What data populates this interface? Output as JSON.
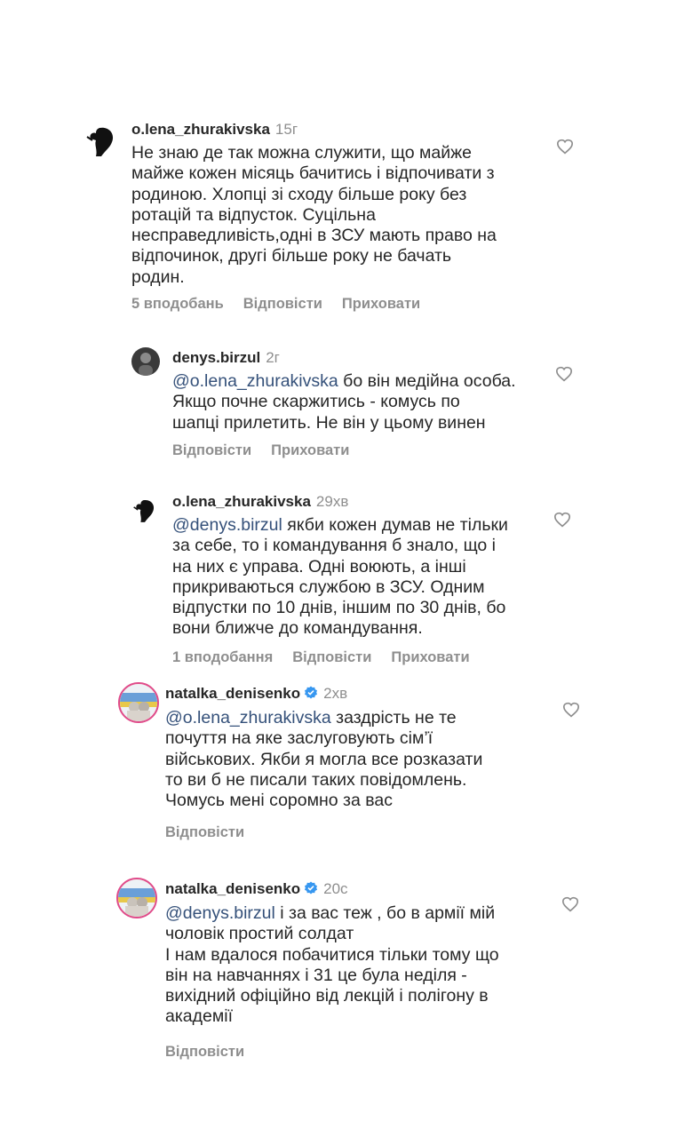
{
  "comments": [
    {
      "username": "o.lena_zhurakivska",
      "time": "15г",
      "mention": "",
      "text": "Не знаю де так можна служити, що майже\nмайже кожен місяць бачитись і відпочивати з\nродиною. Хлопці зі сходу більше року без\nротацій та відпусток. Суцільна\nнесправедливість,одні в ЗСУ мають право на\nвідпочинок, другі більше року не бачать\nродин.",
      "likes": "5 вподобань",
      "reply": "Відповісти",
      "hide": "Приховати"
    },
    {
      "username": "denys.birzul",
      "time": "2г",
      "mention": "@o.lena_zhurakivska",
      "text": " бо він медійна особа.\nЯкщо почне скаржитись - комусь по\nшапці прилетить. Не він у цьому винен",
      "reply": "Відповісти",
      "hide": "Приховати"
    },
    {
      "username": "o.lena_zhurakivska",
      "time": "29хв",
      "mention": "@denys.birzul",
      "text": " якби кожен думав не тільки\nза себе, то і командування б знало, що і\nна них є управа. Одні воюють, а інші\nприкриваються службою  в ЗСУ. Одним\nвідпустки по 10 днів, іншим по 30 днів, бо\nвони ближче до командування.",
      "likes": "1 вподобання",
      "reply": "Відповісти",
      "hide": "Приховати"
    },
    {
      "username": "natalka_denisenko",
      "time": "2хв",
      "mention": "@o.lena_zhurakivska",
      "text": " заздрість не те\nпочуття на яке заслуговують сім’ї\nвійськових. Якби я могла все розказати\nто ви б не писали таких повідомлень.\nЧомусь мені соромно за вас",
      "reply": "Відповісти"
    },
    {
      "username": "natalka_denisenko",
      "time": "20с",
      "mention": "@denys.birzul",
      "text": " і за вас теж , бо в армії мій\nчоловік простий солдат\nІ нам вдалося побачитися тільки тому що\nвін на навчаннях і 31 це була неділя -\nвихідний офіційно від лекцій і полігону в\nакадемії",
      "reply": "Відповісти"
    }
  ],
  "colors": {
    "text": "#262626",
    "muted": "#8e8e8e",
    "mention": "#35517a",
    "verified": "#3797f0"
  }
}
